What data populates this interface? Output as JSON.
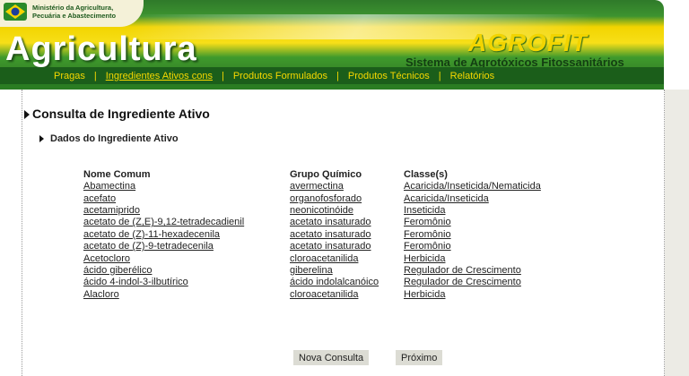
{
  "header": {
    "ministry_line1": "Ministério da Agricultura,",
    "ministry_line2": "Pecuária e Abastecimento",
    "title": "Agricultura",
    "brand": "AGROFIT",
    "subtitle": "Sistema de Agrotóxicos Fitossanitários"
  },
  "nav": [
    {
      "label": "Pragas"
    },
    {
      "label": "Ingredientes Ativos cons"
    },
    {
      "label": "Produtos Formulados"
    },
    {
      "label": "Produtos Técnicos"
    },
    {
      "label": "Relatórios"
    }
  ],
  "page": {
    "title": "Consulta de Ingrediente Ativo",
    "section": "Dados do Ingrediente Ativo"
  },
  "table": {
    "headers": [
      "Nome Comum",
      "Grupo Químico",
      "Classe(s)"
    ],
    "rows": [
      [
        "Abamectina",
        "avermectina",
        "Acaricida/Inseticida/Nematicida"
      ],
      [
        "acefato",
        "organofosforado",
        "Acaricida/Inseticida"
      ],
      [
        "acetamiprido",
        "neonicotinóide",
        "Inseticida"
      ],
      [
        "acetato de (Z,E)-9,12-tetradecadienil",
        "acetato insaturado",
        "Feromônio"
      ],
      [
        "acetato de (Z)-11-hexadecenila",
        "acetato insaturado",
        "Feromônio"
      ],
      [
        "acetato de (Z)-9-tetradecenila",
        "acetato insaturado",
        "Feromônio"
      ],
      [
        "Acetocloro",
        "cloroacetanilida",
        "Herbicida"
      ],
      [
        "ácido giberélico",
        "giberelina",
        "Regulador de Crescimento"
      ],
      [
        "ácido 4-indol-3-ilbutírico",
        "ácido indolalcanóico",
        "Regulador de Crescimento"
      ],
      [
        "Alacloro",
        "cloroacetanilida",
        "Herbicida"
      ]
    ]
  },
  "buttons": {
    "new_query": "Nova Consulta",
    "next": "Próximo"
  }
}
